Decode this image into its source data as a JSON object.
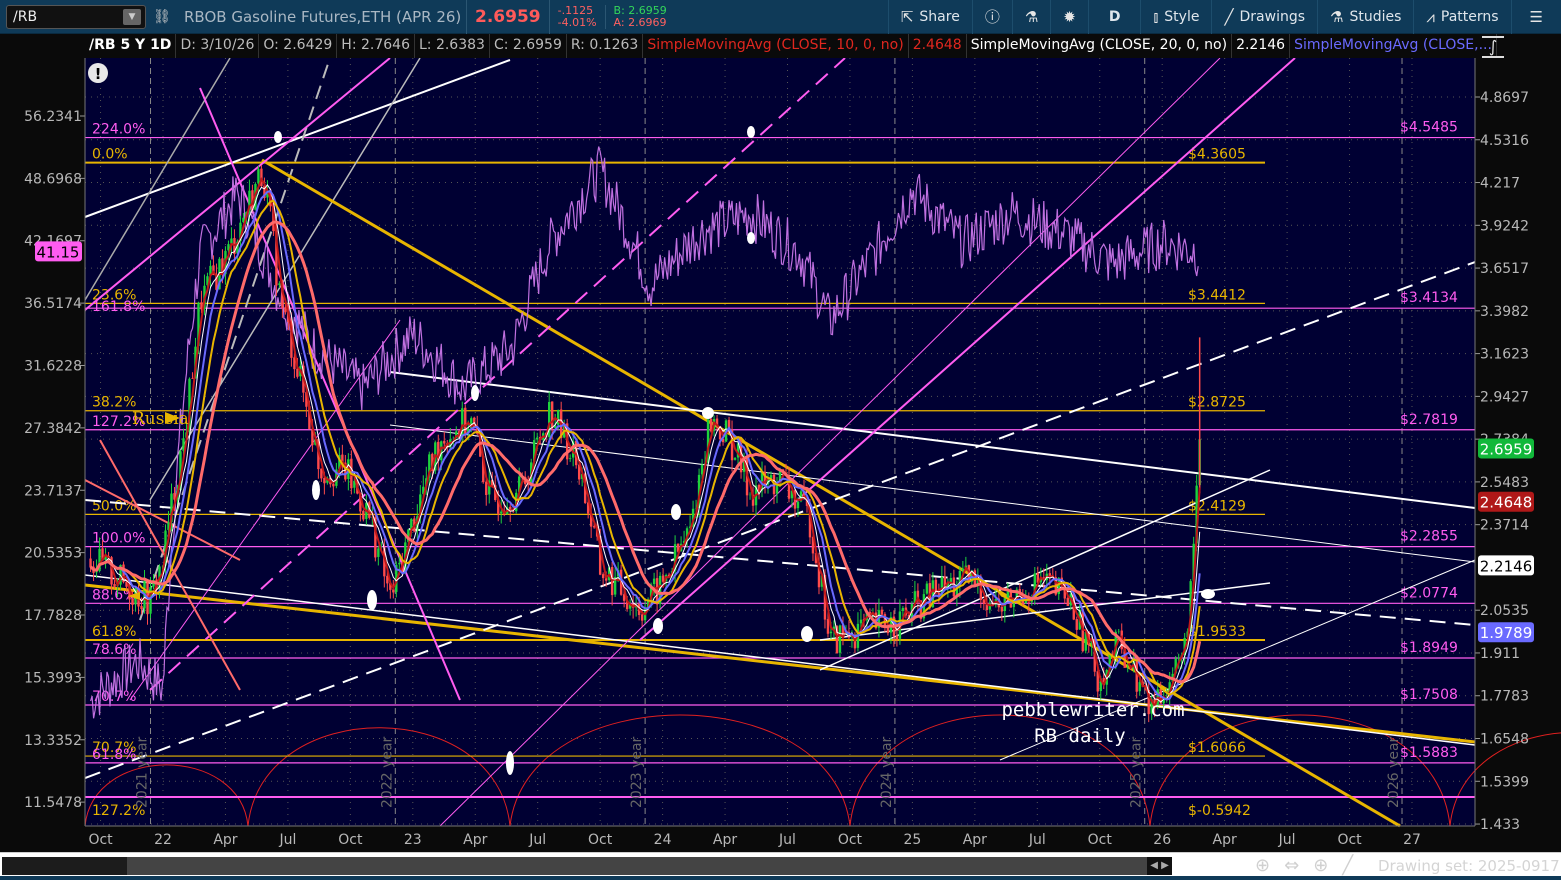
{
  "toolbar": {
    "symbol": "/RB",
    "description": "RBOB Gasoline Futures,ETH (APR 26)",
    "last": "2.6959",
    "change": "-.1125",
    "change_pct": "-4.01%",
    "bid": "B: 2.6959",
    "ask": "A: 2.6969",
    "share": "Share",
    "period": "D",
    "style": "Style",
    "drawings": "Drawings",
    "studies": "Studies",
    "patterns": "Patterns"
  },
  "legend": {
    "title": "/RB 5 Y 1D",
    "date": "D: 3/10/26",
    "open": "O: 2.6429",
    "high": "H: 2.7646",
    "low": "L: 2.6383",
    "close": "C: 2.6959",
    "range": "R: 0.1263",
    "sma10": "SimpleMovingAvg (CLOSE, 10, 0, no)",
    "sma10_value": "2.4648",
    "sma20": "SimpleMovingAvg (CLOSE, 20, 0, no)",
    "sma20_value": "2.2146",
    "sma3": "SimpleMovingAvg (CLOSE,..."
  },
  "colors": {
    "bg": "#000033",
    "gold": "#e8b500",
    "pink": "#ff5cf0",
    "up": "#1ed23c",
    "down": "#ff4a4a",
    "sma10": "#c01818",
    "sma20": "#ffffff",
    "smaSalmon": "#ff6a6a",
    "smaBlue": "#6a6aff",
    "smaGold": "#e8b500",
    "osc": "#c070e0"
  },
  "chart_data": {
    "type": "line",
    "title": "/RB 5 Y 1D",
    "right_axis_ticks": [
      "4.8697",
      "4.5316",
      "4.217",
      "3.9242",
      "3.6517",
      "3.3982",
      "3.1623",
      "2.9427",
      "2.7384",
      "2.5483",
      "2.3714",
      "2.0535",
      "1.911",
      "1.7783",
      "1.6548",
      "1.5399",
      "1.433"
    ],
    "left_axis_ticks": [
      "56.2341",
      "48.6968",
      "42.1697",
      "36.5174",
      "31.6228",
      "27.3842",
      "23.7137",
      "20.5353",
      "17.7828",
      "15.3993",
      "13.3352",
      "11.5478"
    ],
    "x_ticks": [
      {
        "t": 2021.75,
        "label": "Oct"
      },
      {
        "t": 2022.0,
        "label": "22"
      },
      {
        "t": 2022.25,
        "label": "Apr"
      },
      {
        "t": 2022.5,
        "label": "Jul"
      },
      {
        "t": 2022.75,
        "label": "Oct"
      },
      {
        "t": 2023.0,
        "label": "23"
      },
      {
        "t": 2023.25,
        "label": "Apr"
      },
      {
        "t": 2023.5,
        "label": "Jul"
      },
      {
        "t": 2023.75,
        "label": "Oct"
      },
      {
        "t": 2024.0,
        "label": "24"
      },
      {
        "t": 2024.25,
        "label": "Apr"
      },
      {
        "t": 2024.5,
        "label": "Jul"
      },
      {
        "t": 2024.75,
        "label": "Oct"
      },
      {
        "t": 2025.0,
        "label": "25"
      },
      {
        "t": 2025.25,
        "label": "Apr"
      },
      {
        "t": 2025.5,
        "label": "Jul"
      },
      {
        "t": 2025.75,
        "label": "Oct"
      },
      {
        "t": 2026.0,
        "label": "26"
      },
      {
        "t": 2026.25,
        "label": "Apr"
      },
      {
        "t": 2026.5,
        "label": "Jul"
      },
      {
        "t": 2026.75,
        "label": "Oct"
      },
      {
        "t": 2027.0,
        "label": "27"
      }
    ],
    "year_markers": [
      {
        "t": 2021.95,
        "label": "2021 year"
      },
      {
        "t": 2022.93,
        "label": "2022 year"
      },
      {
        "t": 2023.93,
        "label": "2023 year"
      },
      {
        "t": 2024.93,
        "label": "2024 year"
      },
      {
        "t": 2025.93,
        "label": "2025 year"
      },
      {
        "t": 2026.96,
        "label": "2026 year"
      }
    ],
    "price_series": [
      [
        2021.71,
        2.24
      ],
      [
        2021.87,
        2.13
      ],
      [
        2021.95,
        2.09
      ],
      [
        2022.0,
        2.24
      ],
      [
        2022.09,
        2.78
      ],
      [
        2022.15,
        3.46
      ],
      [
        2022.27,
        3.77
      ],
      [
        2022.4,
        4.31
      ],
      [
        2022.47,
        3.46
      ],
      [
        2022.55,
        3.02
      ],
      [
        2022.63,
        2.6
      ],
      [
        2022.73,
        2.6
      ],
      [
        2022.83,
        2.39
      ],
      [
        2022.91,
        2.09
      ],
      [
        2022.99,
        2.35
      ],
      [
        2023.11,
        2.74
      ],
      [
        2023.23,
        2.83
      ],
      [
        2023.31,
        2.47
      ],
      [
        2023.43,
        2.51
      ],
      [
        2023.55,
        2.88
      ],
      [
        2023.67,
        2.6
      ],
      [
        2023.75,
        2.2
      ],
      [
        2023.91,
        2.06
      ],
      [
        2023.99,
        2.13
      ],
      [
        2024.11,
        2.35
      ],
      [
        2024.19,
        2.83
      ],
      [
        2024.27,
        2.74
      ],
      [
        2024.35,
        2.51
      ],
      [
        2024.47,
        2.56
      ],
      [
        2024.59,
        2.39
      ],
      [
        2024.67,
        1.95
      ],
      [
        2024.79,
        1.99
      ],
      [
        2024.95,
        2.02
      ],
      [
        2025.11,
        2.13
      ],
      [
        2025.23,
        2.16
      ],
      [
        2025.35,
        2.06
      ],
      [
        2025.51,
        2.16
      ],
      [
        2025.63,
        2.09
      ],
      [
        2025.75,
        1.83
      ],
      [
        2025.83,
        1.95
      ],
      [
        2025.95,
        1.74
      ],
      [
        2026.03,
        1.83
      ],
      [
        2026.09,
        1.92
      ],
      [
        2026.13,
        2.31
      ],
      [
        2026.15,
        2.6959
      ]
    ],
    "oscillator_series": [
      [
        2021.71,
        14.6
      ],
      [
        2021.9,
        16
      ],
      [
        2022.0,
        15
      ],
      [
        2022.15,
        41
      ],
      [
        2022.3,
        47
      ],
      [
        2022.45,
        38
      ],
      [
        2022.6,
        33
      ],
      [
        2022.8,
        30
      ],
      [
        2023.0,
        34
      ],
      [
        2023.2,
        30
      ],
      [
        2023.4,
        33
      ],
      [
        2023.55,
        42
      ],
      [
        2023.75,
        49.7
      ],
      [
        2023.95,
        38
      ],
      [
        2024.15,
        43
      ],
      [
        2024.35,
        45
      ],
      [
        2024.55,
        41
      ],
      [
        2024.67,
        35
      ],
      [
        2024.85,
        41
      ],
      [
        2025.0,
        47.4
      ],
      [
        2025.2,
        42
      ],
      [
        2025.4,
        45
      ],
      [
        2025.6,
        43
      ],
      [
        2025.8,
        40
      ],
      [
        2026.0,
        42
      ],
      [
        2026.15,
        41.15
      ]
    ],
    "fib_levels_gold": [
      {
        "pct": "0.0%",
        "price": 4.3605,
        "label": "$4.3605"
      },
      {
        "pct": "23.6%",
        "price": 3.4412,
        "label": "$3.4412"
      },
      {
        "pct": "38.2%",
        "price": 2.8725,
        "label": "$2.8725"
      },
      {
        "pct": "50.0%",
        "price": 2.4129,
        "label": "$2.4129"
      },
      {
        "pct": "61.8%",
        "price": 1.9533,
        "label": "$1.9533"
      },
      {
        "pct": "70.7%",
        "price": 1.6066,
        "label": "$1.6066"
      },
      {
        "pct": "127.2%",
        "price": -0.5942,
        "label": "$-0.5942"
      }
    ],
    "fib_levels_pink": [
      {
        "pct": "224.0%",
        "price": 4.5485,
        "label": "$4.5485"
      },
      {
        "pct": "161.8%",
        "price": 3.4134,
        "label": "$3.4134"
      },
      {
        "pct": "127.2%",
        "price": 2.7819,
        "label": "$2.7819"
      },
      {
        "pct": "100.0%",
        "price": 2.2855,
        "label": "$2.2855"
      },
      {
        "pct": "88.6%",
        "price": 2.0774,
        "label": "$2.0774"
      },
      {
        "pct": "78.6%",
        "price": 1.8949,
        "label": "$1.8949"
      },
      {
        "pct": "70.7%",
        "price": 1.7508,
        "label": "$1.7508"
      },
      {
        "pct": "61.8%",
        "price": 1.5883,
        "label": "$1.5883"
      }
    ],
    "price_badges": [
      {
        "value": "2.6959",
        "color": "#11b83a",
        "text": "#ffffff"
      },
      {
        "value": "2.4648",
        "color": "#b01818",
        "text": "#ffffff"
      },
      {
        "value": "2.2146",
        "color": "#ffffff",
        "text": "#000000"
      },
      {
        "value": "1.9789",
        "color": "#6a6aff",
        "text": "#ffffff"
      }
    ],
    "oscillator_badge": "41.15",
    "annotation_russia": "Russia",
    "watermark_line1": "pebblewriter.com",
    "watermark_line2": "RB daily"
  },
  "bottom": {
    "drawing_set": "Drawing set: 2025-0917"
  }
}
